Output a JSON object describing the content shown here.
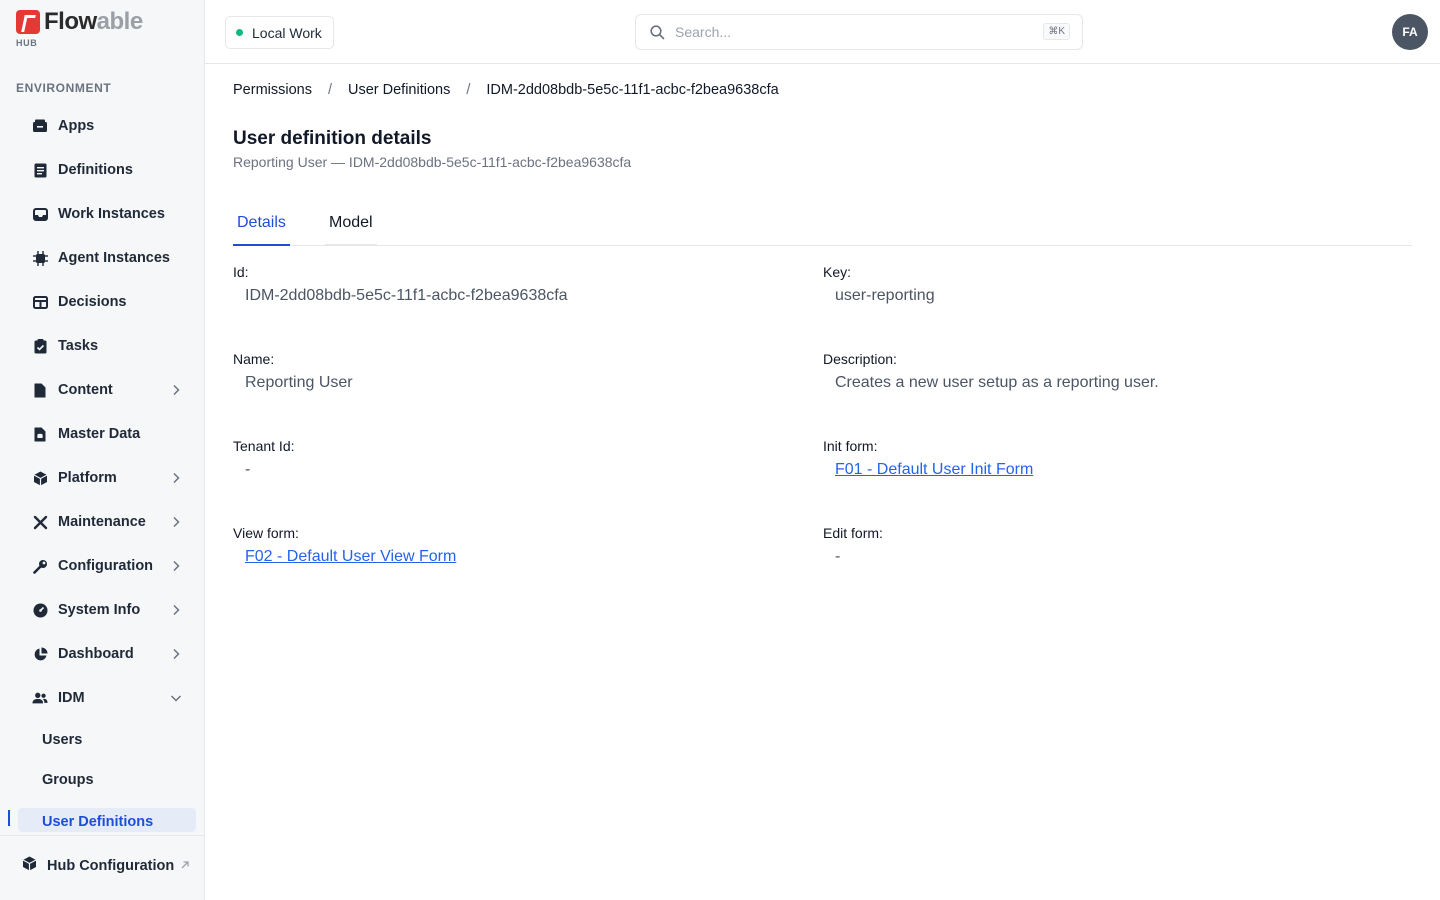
{
  "brand": {
    "name_dark": "Flow",
    "name_grey": "able",
    "sub": "HUB",
    "accent": "#e53935"
  },
  "sidebar": {
    "section": "ENVIRONMENT",
    "items": [
      {
        "label": "Apps",
        "icon": "apps-box-icon",
        "chevron": "none"
      },
      {
        "label": "Definitions",
        "icon": "definitions-book-icon",
        "chevron": "none"
      },
      {
        "label": "Work Instances",
        "icon": "inbox-tray-icon",
        "chevron": "none"
      },
      {
        "label": "Agent Instances",
        "icon": "chip-icon",
        "chevron": "none"
      },
      {
        "label": "Decisions",
        "icon": "table-grid-icon",
        "chevron": "none"
      },
      {
        "label": "Tasks",
        "icon": "clipboard-check-icon",
        "chevron": "none"
      },
      {
        "label": "Content",
        "icon": "document-icon",
        "chevron": "right"
      },
      {
        "label": "Master Data",
        "icon": "database-file-icon",
        "chevron": "none"
      },
      {
        "label": "Platform",
        "icon": "cube-icon",
        "chevron": "right"
      },
      {
        "label": "Maintenance",
        "icon": "tools-icon",
        "chevron": "right"
      },
      {
        "label": "Configuration",
        "icon": "wrench-icon",
        "chevron": "right"
      },
      {
        "label": "System Info",
        "icon": "gauge-icon",
        "chevron": "right"
      },
      {
        "label": "Dashboard",
        "icon": "pie-chart-icon",
        "chevron": "right"
      },
      {
        "label": "IDM",
        "icon": "users-icon",
        "chevron": "down"
      }
    ],
    "idm_sub": [
      "Users",
      "Groups",
      "User Definitions"
    ],
    "footer_label": "Hub Configuration"
  },
  "topbar": {
    "environment": "Local Work",
    "search_placeholder": "Search...",
    "shortcut": "⌘K",
    "avatar_initials": "FA"
  },
  "breadcrumb": [
    "Permissions",
    "User Definitions",
    "IDM-2dd08bdb-5e5c-11f1-acbc-f2bea9638cfa"
  ],
  "page": {
    "title": "User definition details",
    "subtitle": "Reporting User — IDM-2dd08bdb-5e5c-11f1-acbc-f2bea9638cfa"
  },
  "tabs": {
    "details": "Details",
    "model": "Model"
  },
  "fields": {
    "id": {
      "label": "Id:",
      "value": "IDM-2dd08bdb-5e5c-11f1-acbc-f2bea9638cfa"
    },
    "key": {
      "label": "Key:",
      "value": "user-reporting"
    },
    "name": {
      "label": "Name:",
      "value": "Reporting User"
    },
    "description": {
      "label": "Description:",
      "value": "Creates a new user setup as a reporting user."
    },
    "tenant": {
      "label": "Tenant Id:",
      "value": "-"
    },
    "init_form": {
      "label": "Init form:",
      "value": "F01 - Default User Init Form"
    },
    "view_form": {
      "label": "View form:",
      "value": "F02 - Default User View Form"
    },
    "edit_form": {
      "label": "Edit form:",
      "value": "-"
    }
  }
}
